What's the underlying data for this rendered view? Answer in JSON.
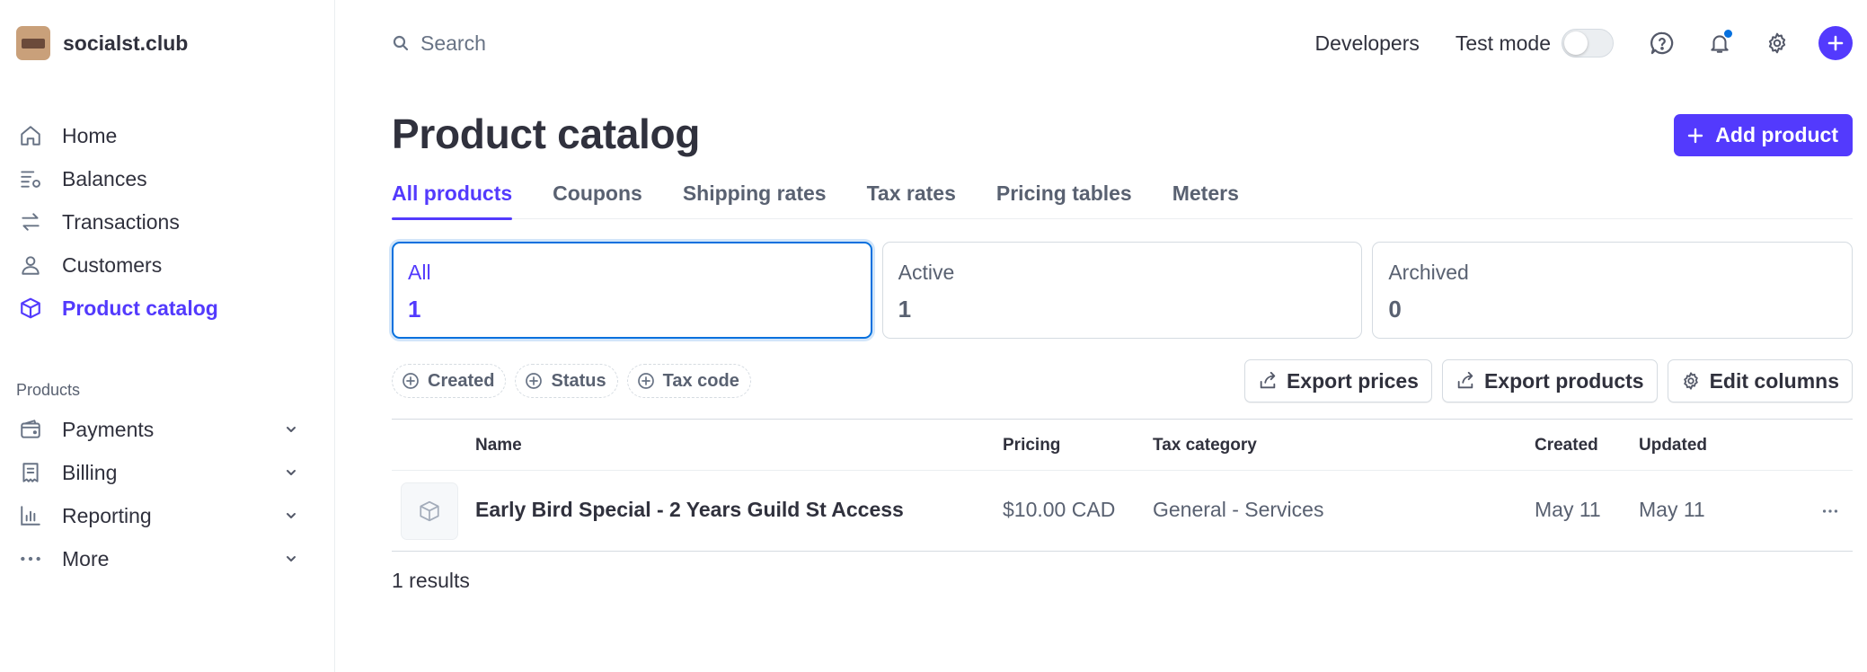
{
  "brand": {
    "name": "socialst.club"
  },
  "sidebar": {
    "items": [
      {
        "label": "Home",
        "icon": "home-icon",
        "active": false
      },
      {
        "label": "Balances",
        "icon": "balances-icon",
        "active": false
      },
      {
        "label": "Transactions",
        "icon": "transactions-icon",
        "active": false
      },
      {
        "label": "Customers",
        "icon": "customers-icon",
        "active": false
      },
      {
        "label": "Product catalog",
        "icon": "product-catalog-icon",
        "active": true
      }
    ],
    "section_title": "Products",
    "product_items": [
      {
        "label": "Payments",
        "icon": "payments-icon"
      },
      {
        "label": "Billing",
        "icon": "billing-icon"
      },
      {
        "label": "Reporting",
        "icon": "reporting-icon"
      },
      {
        "label": "More",
        "icon": "more-dots-icon"
      }
    ]
  },
  "topbar": {
    "search_placeholder": "Search",
    "developers_label": "Developers",
    "test_mode_label": "Test mode",
    "test_mode_on": false
  },
  "page": {
    "title": "Product catalog",
    "add_button_label": "Add product"
  },
  "tabs": [
    {
      "label": "All products",
      "active": true
    },
    {
      "label": "Coupons",
      "active": false
    },
    {
      "label": "Shipping rates",
      "active": false
    },
    {
      "label": "Tax rates",
      "active": false
    },
    {
      "label": "Pricing tables",
      "active": false
    },
    {
      "label": "Meters",
      "active": false
    }
  ],
  "status_cards": [
    {
      "label": "All",
      "count": "1",
      "active": true
    },
    {
      "label": "Active",
      "count": "1",
      "active": false
    },
    {
      "label": "Archived",
      "count": "0",
      "active": false
    }
  ],
  "filters": [
    {
      "label": "Created"
    },
    {
      "label": "Status"
    },
    {
      "label": "Tax code"
    }
  ],
  "actions": {
    "export_prices": "Export prices",
    "export_products": "Export products",
    "edit_columns": "Edit columns"
  },
  "table": {
    "columns": {
      "name": "Name",
      "pricing": "Pricing",
      "tax_category": "Tax category",
      "created": "Created",
      "updated": "Updated"
    },
    "rows": [
      {
        "name": "Early Bird Special - 2 Years Guild St Access",
        "pricing": "$10.00 CAD",
        "tax_category": "General - Services",
        "created": "May 11",
        "updated": "May 11"
      }
    ]
  },
  "results_text": "1 results",
  "colors": {
    "accent": "#533afd",
    "focus_ring": "#0570de",
    "text_primary": "#30313d",
    "text_secondary": "#596171"
  }
}
